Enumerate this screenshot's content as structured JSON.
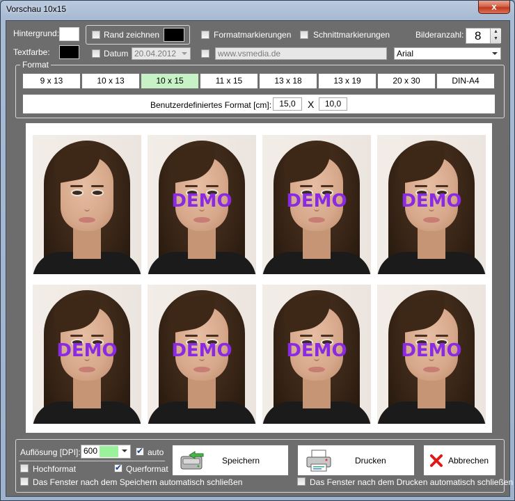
{
  "window": {
    "title": "Vorschau 10x15",
    "close_label": "x"
  },
  "options": {
    "background_label": "Hintergrund:",
    "textcolor_label": "Textfarbe:",
    "background_color": "#ffffff",
    "text_color": "#000000",
    "border_draw_label": "Rand zeichnen",
    "border_draw_checked": false,
    "border_color": "#000000",
    "date_label": "Datum",
    "date_checked": false,
    "date_value": "20.04.2012",
    "format_marks_label": "Formatmarkierungen",
    "format_marks_checked": false,
    "cut_marks_label": "Schnittmarkierungen",
    "cut_marks_checked": false,
    "url_checked": false,
    "url_value": "www.vsmedia.de",
    "image_count_label": "Bilderanzahl:",
    "image_count_value": "8",
    "font_value": "Arial"
  },
  "format": {
    "legend": "Format",
    "buttons": [
      "9 x 13",
      "10 x 13",
      "10 x 15",
      "11 x 15",
      "13 x 18",
      "13 x 19",
      "20 x 30",
      "DIN-A4"
    ],
    "active": "10 x 15",
    "custom_label": "Benutzerdefiniertes Format [cm]:",
    "custom_width": "15,0",
    "custom_x": "X",
    "custom_height": "10,0"
  },
  "preview": {
    "watermark": "DEMO",
    "photo_count": 8,
    "watermark_on": [
      false,
      true,
      true,
      true,
      true,
      true,
      true,
      true
    ],
    "watermark_color": "#8a2be2"
  },
  "bottom": {
    "dpi_label": "Auflösung [DPI]:",
    "dpi_value": "600",
    "auto_label": "auto",
    "auto_checked": true,
    "portrait_label": "Hochformat",
    "portrait_checked": false,
    "landscape_label": "Querformat",
    "landscape_checked": true,
    "save_label": "Speichern",
    "print_label": "Drucken",
    "cancel_label": "Abbrechen",
    "close_after_save_label": "Das Fenster nach dem Speichern automatisch schließen",
    "close_after_print_label": "Das Fenster nach dem Drucken automatisch schließen"
  }
}
